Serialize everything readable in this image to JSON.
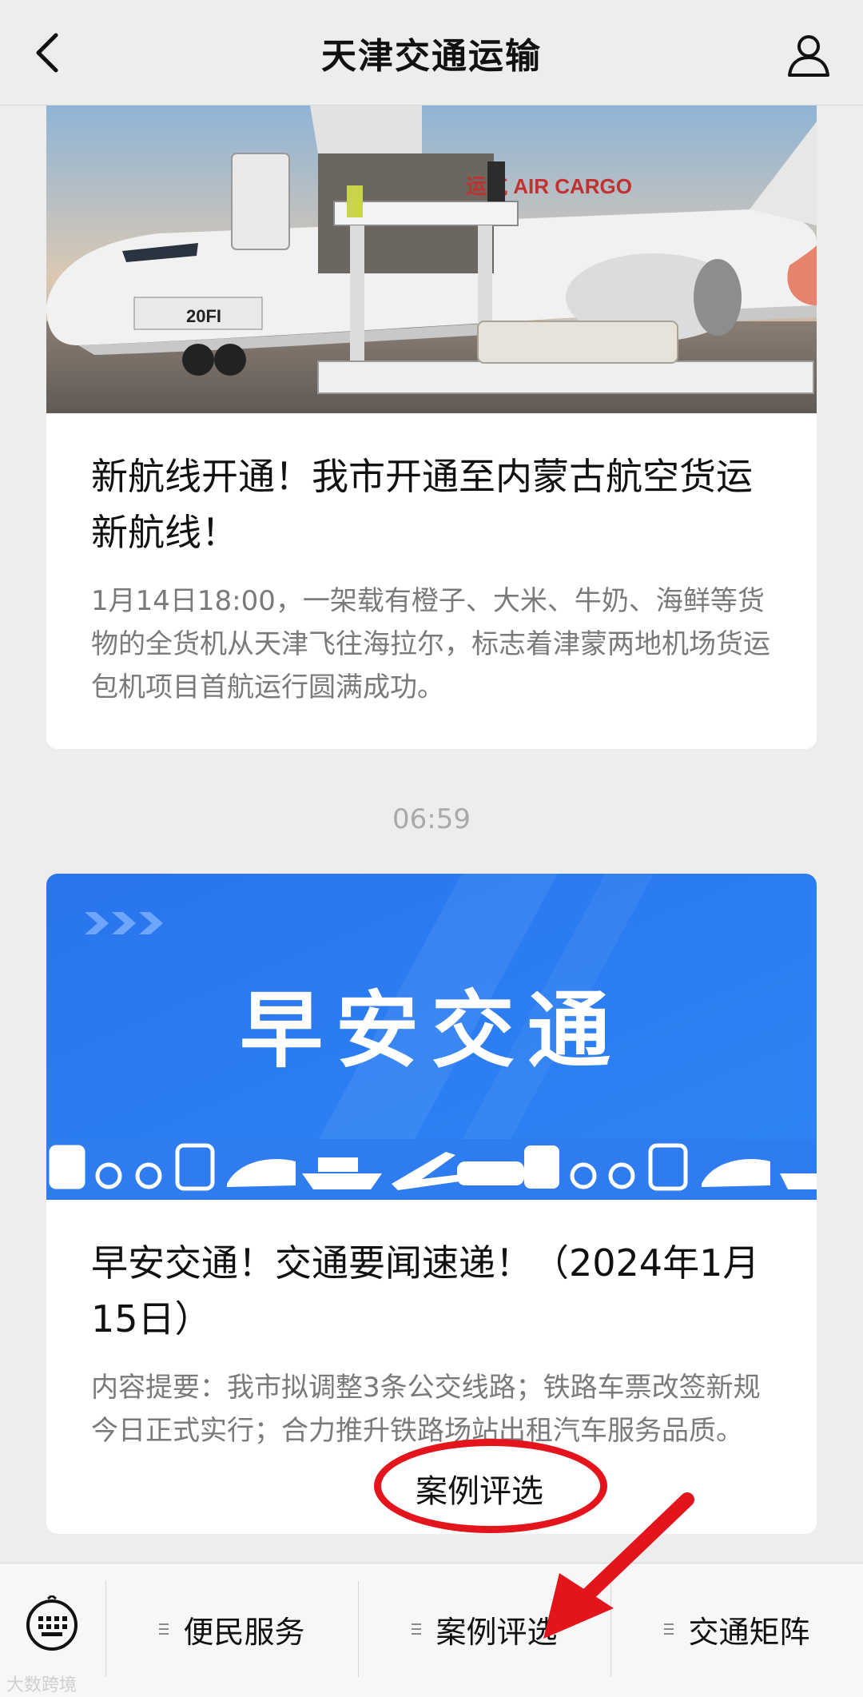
{
  "header": {
    "title": "天津交通运输"
  },
  "articles": [
    {
      "cover_text": "运航 AIR CARGO",
      "title": "新航线开通！我市开通至内蒙古航空货运新航线！",
      "summary": "1月14日18:00，一架载有橙子、大米、牛奶、海鲜等货物的全货机从天津飞往海拉尔，标志着津蒙两地机场货运包机项目首航运行圆满成功。"
    },
    {
      "cover_text": "早安交通",
      "title": "早安交通！交通要闻速递！（2024年1月15日）",
      "summary": "内容提要：我市拟调整3条公交线路；铁路车票改签新规今日正式实行；合力推升铁路场站出租汽车服务品质。"
    }
  ],
  "time_label": "06:59",
  "popup": {
    "label": "案例评选"
  },
  "menu": {
    "items": [
      {
        "label": "便民服务"
      },
      {
        "label": "案例评选"
      },
      {
        "label": "交通矩阵"
      }
    ]
  },
  "watermark": "大数跨境",
  "colors": {
    "background": "#ededed",
    "annotation_red": "#e4141c",
    "cover_blue": "#2f7cf0"
  }
}
